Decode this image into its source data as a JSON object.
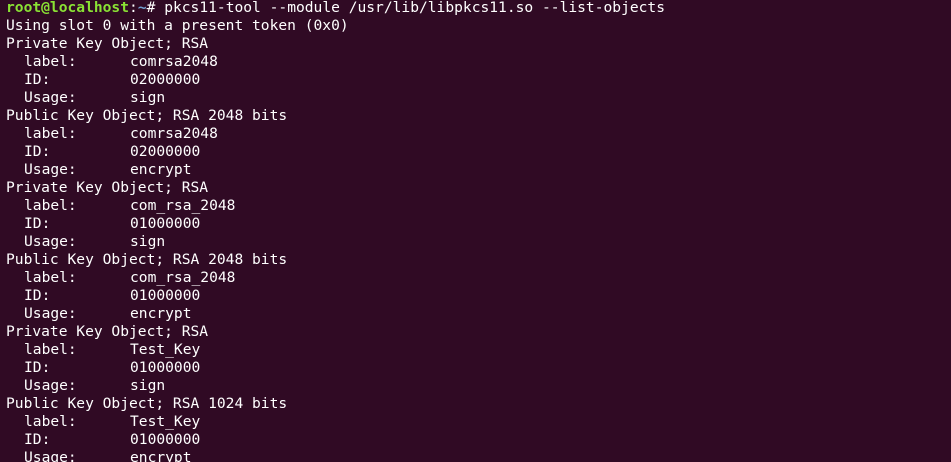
{
  "colors": {
    "background": "#300a24",
    "text": "#ffffff",
    "prompt_user": "#8ae234",
    "prompt_path": "#729fcf"
  },
  "prompt": {
    "user_host": "root@localhost",
    "separator": ":",
    "path": "~",
    "symbol": "# ",
    "command": "pkcs11-tool --module /usr/lib/libpkcs11.so --list-objects"
  },
  "output": {
    "slot_line": "Using slot 0 with a present token (0x0)",
    "objects": [
      {
        "header": "Private Key Object; RSA",
        "fields": [
          {
            "key": "label:",
            "value": "comrsa2048"
          },
          {
            "key": "ID:",
            "value": "02000000"
          },
          {
            "key": "Usage:",
            "value": "sign"
          }
        ]
      },
      {
        "header": "Public Key Object; RSA 2048 bits",
        "fields": [
          {
            "key": "label:",
            "value": "comrsa2048"
          },
          {
            "key": "ID:",
            "value": "02000000"
          },
          {
            "key": "Usage:",
            "value": "encrypt"
          }
        ]
      },
      {
        "header": "Private Key Object; RSA",
        "fields": [
          {
            "key": "label:",
            "value": "com_rsa_2048"
          },
          {
            "key": "ID:",
            "value": "01000000"
          },
          {
            "key": "Usage:",
            "value": "sign"
          }
        ]
      },
      {
        "header": "Public Key Object; RSA 2048 bits",
        "fields": [
          {
            "key": "label:",
            "value": "com_rsa_2048"
          },
          {
            "key": "ID:",
            "value": "01000000"
          },
          {
            "key": "Usage:",
            "value": "encrypt"
          }
        ]
      },
      {
        "header": "Private Key Object; RSA",
        "fields": [
          {
            "key": "label:",
            "value": "Test_Key"
          },
          {
            "key": "ID:",
            "value": "01000000"
          },
          {
            "key": "Usage:",
            "value": "sign"
          }
        ]
      },
      {
        "header": "Public Key Object; RSA 1024 bits",
        "fields": [
          {
            "key": "label:",
            "value": "Test_Key"
          },
          {
            "key": "ID:",
            "value": "01000000"
          },
          {
            "key": "Usage:",
            "value": "encrypt"
          }
        ]
      }
    ]
  }
}
